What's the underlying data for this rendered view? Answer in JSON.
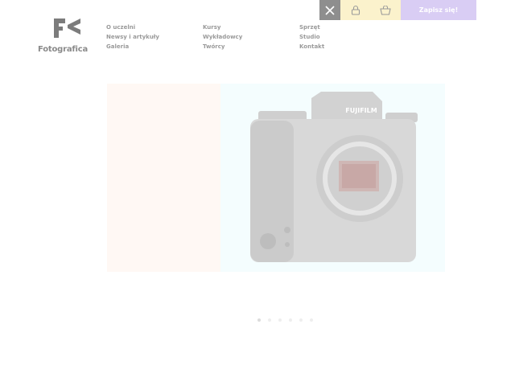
{
  "brand": {
    "name": "Fotografica"
  },
  "nav": {
    "col1": [
      "O uczelni",
      "Newsy i artykuły",
      "Galeria"
    ],
    "col2": [
      "Kursy",
      "Wykładowcy",
      "Twórcy"
    ],
    "col3": [
      "Sprzęt",
      "Studio",
      "Kontakt"
    ]
  },
  "header": {
    "signup_label": "Zapisz się!",
    "close_icon": "close-icon",
    "user_icon": "user-icon",
    "cart_icon": "cart-icon"
  },
  "hero": {
    "camera_brand": "FUJIFILM",
    "colors": {
      "left_panel": "#fff8f4",
      "right_panel": "#f4fdfe"
    }
  },
  "slider": {
    "dot_count": 6,
    "active_index": 0
  },
  "colors": {
    "signup_bg": "#d9cdf4",
    "icon_bg": "#fbf2cc",
    "close_bg": "#8e8e8e"
  }
}
